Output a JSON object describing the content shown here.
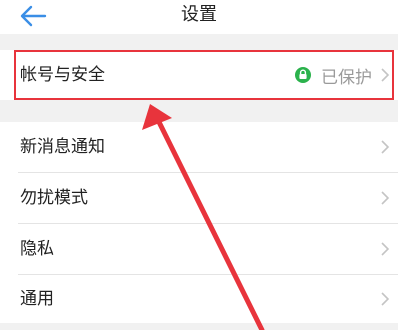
{
  "nav": {
    "title": "设置"
  },
  "rows": [
    {
      "label": "帐号与安全",
      "status": "已保护"
    },
    {
      "label": "新消息通知"
    },
    {
      "label": "勿扰模式"
    },
    {
      "label": "隐私"
    },
    {
      "label": "通用"
    }
  ],
  "icons": {
    "back": "arrow-left-icon",
    "lock": "lock-icon",
    "chevron": "chevron-right-icon"
  },
  "colors": {
    "accent": "#3a8ee6",
    "status_green": "#2bb24c",
    "annotation_red": "#e8343c"
  }
}
